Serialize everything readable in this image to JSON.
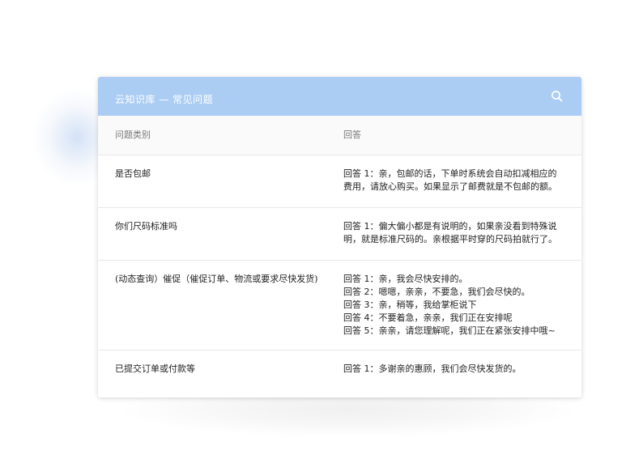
{
  "header": {
    "title": "云知识库 — 常见问题",
    "search_icon": "search-icon"
  },
  "colors": {
    "header_bg": "#abcdf3",
    "table_head_bg": "#fafafa",
    "divider": "#e8e8e8"
  },
  "table": {
    "columns": [
      "问题类别",
      "回答"
    ],
    "rows": [
      {
        "question": "是否包邮",
        "answers": [
          "回答 1：亲，包邮的话，下单时系统会自动扣减相应的费用，请放心购买。如果显示了邮费就是不包邮的额。"
        ]
      },
      {
        "question": "你们尺码标准吗",
        "answers": [
          "回答 1：偏大偏小都是有说明的，如果亲没看到特殊说明，就是标准尺码的。亲根据平时穿的尺码拍就行了。"
        ]
      },
      {
        "question": "(动态查询）催促（催促订单、物流或要求尽快发货)",
        "answers": [
          "回答 1：亲，我会尽快安排的。",
          "回答 2：嗯嗯，亲亲，不要急，我们会尽快的。",
          "回答 3：亲，稍等，我给掌柜说下",
          "回答 4：不要着急，亲亲，我们正在安排呢",
          "回答 5：亲亲，请您理解呢，我们正在紧张安排中哦~"
        ]
      },
      {
        "question": "已提交订单或付款等",
        "answers": [
          "回答 1：多谢亲的惠顾，我们会尽快发货的。"
        ]
      }
    ]
  }
}
